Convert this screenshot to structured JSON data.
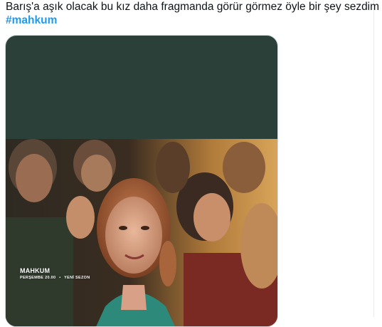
{
  "tweet": {
    "text_line1": "Barış'a aşık olacak bu kız daha fragmanda görür görmez öyle bir şey sezdim",
    "hashtag": "#mahkum"
  },
  "media": {
    "overlay_title": "MAHKUM",
    "overlay_day_time": "PERŞEMBE 20.00",
    "overlay_separator": "•",
    "overlay_season": "YENİ SEZON",
    "background_color": "#2a4038"
  }
}
